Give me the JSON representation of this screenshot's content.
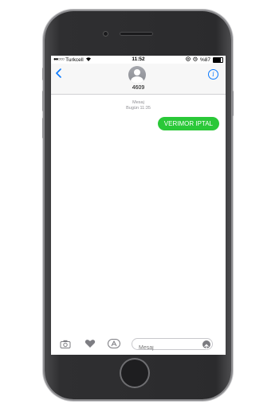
{
  "status_bar": {
    "signal_dots": "●●○○○",
    "carrier": "Turkcell",
    "time": "11:52",
    "battery": "%87"
  },
  "header": {
    "back_icon": "chevron-left-icon",
    "contact_name": "4609",
    "info_icon": "info-icon"
  },
  "conversation": {
    "service_label": "Mesaj",
    "timestamp": "Bugün 11:35",
    "messages": [
      {
        "text": "VERIMOR IPTAL",
        "direction": "outgoing",
        "color": "#2ac838"
      }
    ]
  },
  "input_bar": {
    "placeholder": "Mesaj",
    "icons": [
      "camera-icon",
      "heart-icon",
      "app-store-icon",
      "send-icon"
    ]
  },
  "colors": {
    "ios_blue": "#0a7aff",
    "bubble_green": "#2ac838"
  }
}
